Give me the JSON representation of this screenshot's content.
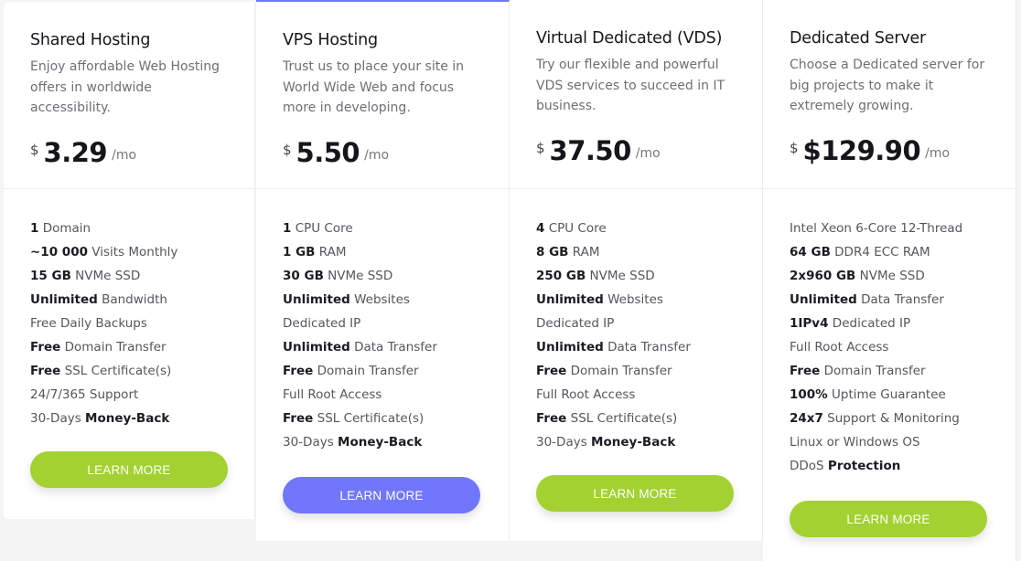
{
  "colors": {
    "accent_green": "#a3d131",
    "accent_purple": "#7177fb",
    "background": "#f4f4f5"
  },
  "plans": [
    {
      "title": "Shared Hosting",
      "description": "Enjoy affordable Web Hosting offers in worldwide accessibility.",
      "currency": "$",
      "price": "3.29",
      "period": "/mo",
      "button": "LEARN MORE",
      "features": [
        {
          "pre": "",
          "b": "1",
          "post": " Domain"
        },
        {
          "pre": "",
          "b": "~10 000",
          "post": " Visits Monthly"
        },
        {
          "pre": "",
          "b": "15 GB",
          "post": " NVMe SSD"
        },
        {
          "pre": "",
          "b": "Unlimited",
          "post": " Bandwidth"
        },
        {
          "pre": "Free Daily Backups",
          "b": "",
          "post": ""
        },
        {
          "pre": "",
          "b": "Free",
          "post": " Domain Transfer"
        },
        {
          "pre": "",
          "b": "Free",
          "post": " SSL Certificate(s)"
        },
        {
          "pre": "24/7/365 Support",
          "b": "",
          "post": ""
        },
        {
          "pre": "30-Days ",
          "b": "Money-Back",
          "post": ""
        }
      ]
    },
    {
      "title": "VPS Hosting",
      "description": "Trust us to place your site in World Wide Web and focus more in developing.",
      "currency": "$",
      "price": "5.50",
      "period": "/mo",
      "button": "LEARN MORE",
      "features": [
        {
          "pre": "",
          "b": "1",
          "post": " CPU Core"
        },
        {
          "pre": "",
          "b": "1 GB",
          "post": " RAM"
        },
        {
          "pre": "",
          "b": "30 GB",
          "post": " NVMe SSD"
        },
        {
          "pre": "",
          "b": "Unlimited",
          "post": " Websites"
        },
        {
          "pre": "Dedicated IP",
          "b": "",
          "post": ""
        },
        {
          "pre": "",
          "b": "Unlimited",
          "post": " Data Transfer"
        },
        {
          "pre": "",
          "b": "Free",
          "post": " Domain Transfer"
        },
        {
          "pre": "Full Root Access",
          "b": "",
          "post": ""
        },
        {
          "pre": "",
          "b": "Free",
          "post": " SSL Certificate(s)"
        },
        {
          "pre": "30-Days ",
          "b": "Money-Back",
          "post": ""
        }
      ]
    },
    {
      "title": "Virtual Dedicated (VDS)",
      "description": "Try our flexible and powerful VDS services to succeed in IT business.",
      "currency": "$",
      "price": "37.50",
      "period": "/mo",
      "button": "LEARN MORE",
      "features": [
        {
          "pre": "",
          "b": "4",
          "post": " CPU Core"
        },
        {
          "pre": "",
          "b": "8 GB",
          "post": " RAM"
        },
        {
          "pre": "",
          "b": "250 GB",
          "post": " NVMe SSD"
        },
        {
          "pre": "",
          "b": "Unlimited",
          "post": " Websites"
        },
        {
          "pre": "Dedicated IP",
          "b": "",
          "post": ""
        },
        {
          "pre": "",
          "b": "Unlimited",
          "post": " Data Transfer"
        },
        {
          "pre": "",
          "b": "Free",
          "post": " Domain Transfer"
        },
        {
          "pre": "Full Root Access",
          "b": "",
          "post": ""
        },
        {
          "pre": "",
          "b": "Free",
          "post": " SSL Certificate(s)"
        },
        {
          "pre": "30-Days ",
          "b": "Money-Back",
          "post": ""
        }
      ]
    },
    {
      "title": "Dedicated Server",
      "description": "Choose a Dedicated server for big projects to make it extremely growing.",
      "currency": "$",
      "price": "$129.90",
      "period": "/mo",
      "button": "LEARN MORE",
      "features": [
        {
          "pre": "Intel Xeon 6-Core 12-Thread",
          "b": "",
          "post": ""
        },
        {
          "pre": "",
          "b": "64 GB",
          "post": " DDR4 ECC RAM"
        },
        {
          "pre": "",
          "b": "2x960 GB",
          "post": " NVMe SSD"
        },
        {
          "pre": "",
          "b": "Unlimited",
          "post": " Data Transfer"
        },
        {
          "pre": "",
          "b": "1IPv4",
          "post": " Dedicated IP"
        },
        {
          "pre": "Full Root Access",
          "b": "",
          "post": ""
        },
        {
          "pre": "",
          "b": "Free",
          "post": " Domain Transfer"
        },
        {
          "pre": "",
          "b": "100%",
          "post": " Uptime Guarantee"
        },
        {
          "pre": "",
          "b": "24x7",
          "post": " Support & Monitoring"
        },
        {
          "pre": "Linux or Windows OS",
          "b": "",
          "post": ""
        },
        {
          "pre": "DDoS ",
          "b": "Protection",
          "post": ""
        }
      ]
    }
  ]
}
